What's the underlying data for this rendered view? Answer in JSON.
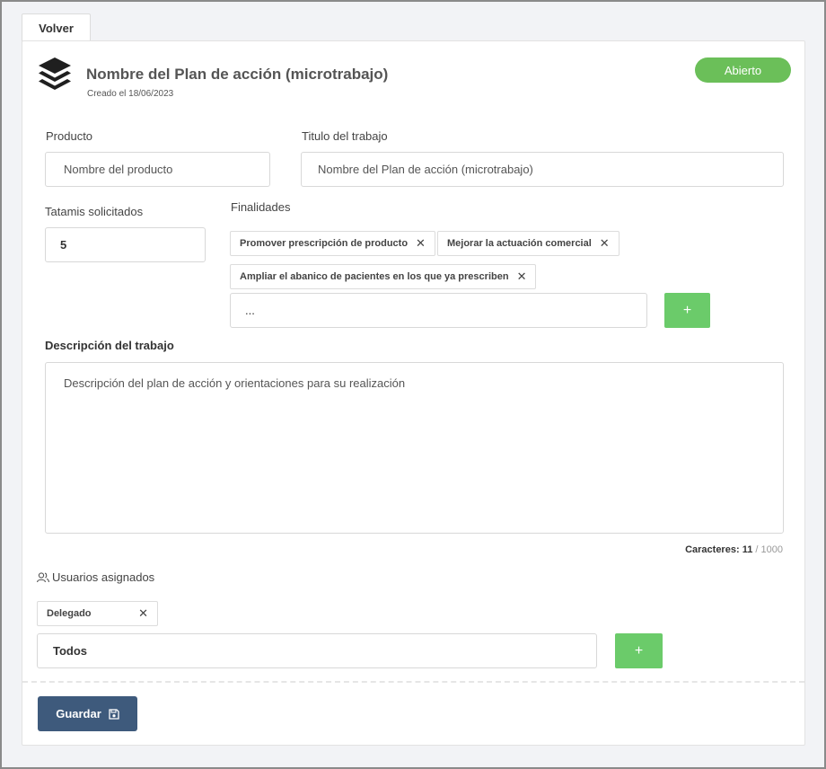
{
  "nav": {
    "back_label": "Volver"
  },
  "header": {
    "icon": "layers-icon",
    "title": "Nombre del Plan de acción (microtrabajo)",
    "created": "Creado el 18/06/2023",
    "status": "Abierto",
    "status_color": "#6bbf59"
  },
  "form": {
    "product": {
      "label": "Producto",
      "placeholder": "Nombre del producto"
    },
    "job_title": {
      "label": "Titulo del trabajo",
      "placeholder": "Nombre del Plan de acción (microtrabajo)"
    },
    "tatamis": {
      "label": "Tatamis solicitados",
      "value": "5"
    },
    "purposes": {
      "label": "Finalidades",
      "chips": [
        "Promover prescripción de producto",
        "Mejorar la actuación comercial",
        "Ampliar el abanico de pacientes en los que ya prescriben"
      ],
      "input_value": "...",
      "add_label": "+"
    },
    "description": {
      "label": "Descripción del trabajo",
      "placeholder": "Descripción del plan de acción y orientaciones para su realización",
      "counter_label": "Caracteres:",
      "counter_current": "11",
      "counter_sep": "/",
      "counter_max": "1000"
    },
    "users": {
      "label": "Usuarios asignados",
      "icon": "users-icon",
      "chips": [
        "Delegado"
      ],
      "input_value": "Todos",
      "add_label": "+"
    }
  },
  "footer": {
    "save_label": "Guardar",
    "save_icon": "floppy-disk-icon"
  },
  "colors": {
    "accent_green": "#6bcb6a",
    "save_button": "#3e5a7c"
  }
}
